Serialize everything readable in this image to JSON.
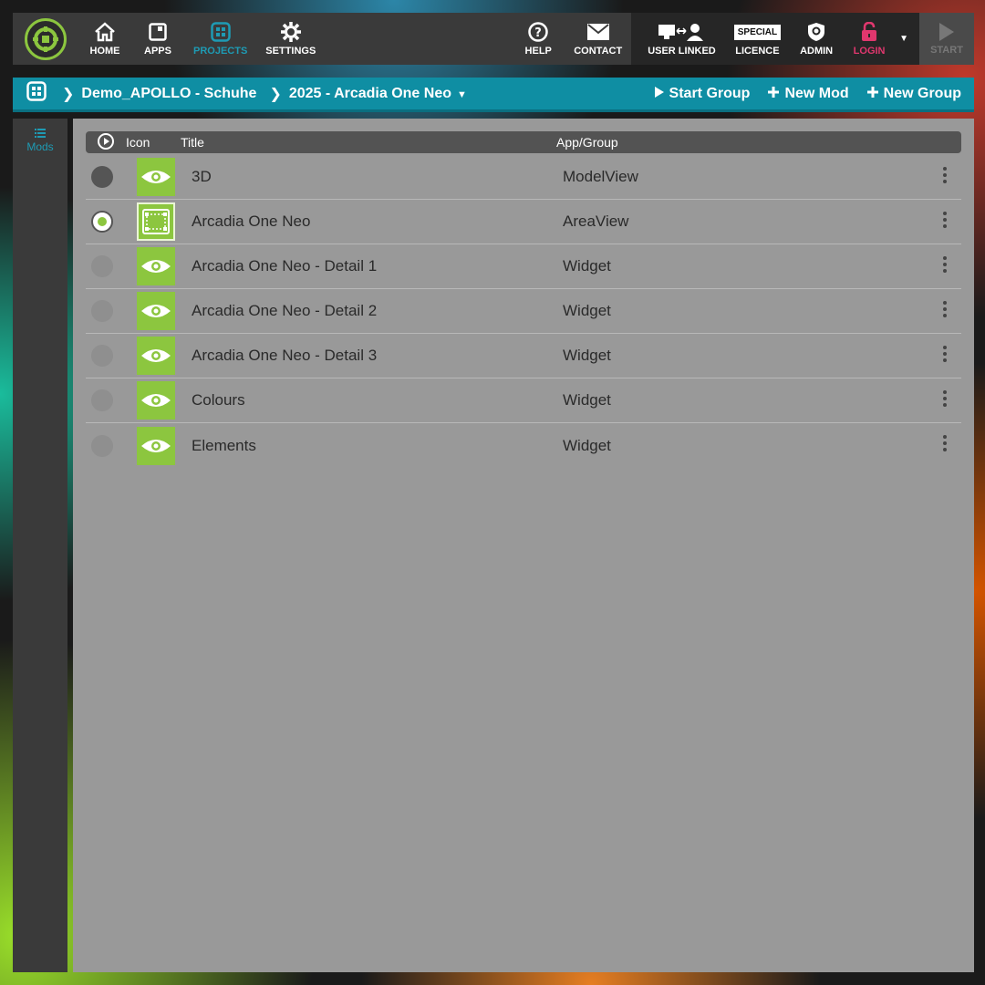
{
  "topnav": {
    "items": [
      {
        "label": "HOME",
        "icon": "home-icon"
      },
      {
        "label": "APPS",
        "icon": "apps-icon"
      },
      {
        "label": "PROJECTS",
        "icon": "projects-icon",
        "active": true
      },
      {
        "label": "SETTINGS",
        "icon": "gear-icon"
      }
    ],
    "help": "HELP",
    "contact": "CONTACT",
    "user_linked": "USER LINKED",
    "licence_badge": "SPECIAL",
    "licence": "LICENCE",
    "admin": "ADMIN",
    "login": "LOGIN",
    "start": "START"
  },
  "breadcrumb": {
    "items": [
      "Demo_APOLLO - Schuhe",
      "2025 - Arcadia One Neo"
    ],
    "actions": [
      {
        "label": "Start Group",
        "icon": "play-icon"
      },
      {
        "label": "New Mod",
        "icon": "plus-icon"
      },
      {
        "label": "New Group",
        "icon": "plus-icon"
      }
    ]
  },
  "sidebar": {
    "mods_label": "Mods"
  },
  "table": {
    "headers": {
      "icon": "Icon",
      "title": "Title",
      "app": "App/Group"
    },
    "rows": [
      {
        "title": "3D",
        "app": "ModelView",
        "icon": "eye-icon",
        "state": "dark"
      },
      {
        "title": "Arcadia One Neo",
        "app": "AreaView",
        "icon": "area-icon",
        "state": "selected"
      },
      {
        "title": "Arcadia One Neo - Detail 1",
        "app": "Widget",
        "icon": "eye-icon",
        "state": "off"
      },
      {
        "title": "Arcadia One Neo - Detail 2",
        "app": "Widget",
        "icon": "eye-icon",
        "state": "off"
      },
      {
        "title": "Arcadia One Neo - Detail 3",
        "app": "Widget",
        "icon": "eye-icon",
        "state": "off"
      },
      {
        "title": "Colours",
        "app": "Widget",
        "icon": "eye-icon",
        "state": "off"
      },
      {
        "title": "Elements",
        "app": "Widget",
        "icon": "eye-icon",
        "state": "off"
      }
    ]
  },
  "colors": {
    "accent": "#1e9bb4",
    "crumb_bar": "#0f8ea3",
    "icon_green": "#8cc63f",
    "login_pink": "#e0376e"
  }
}
